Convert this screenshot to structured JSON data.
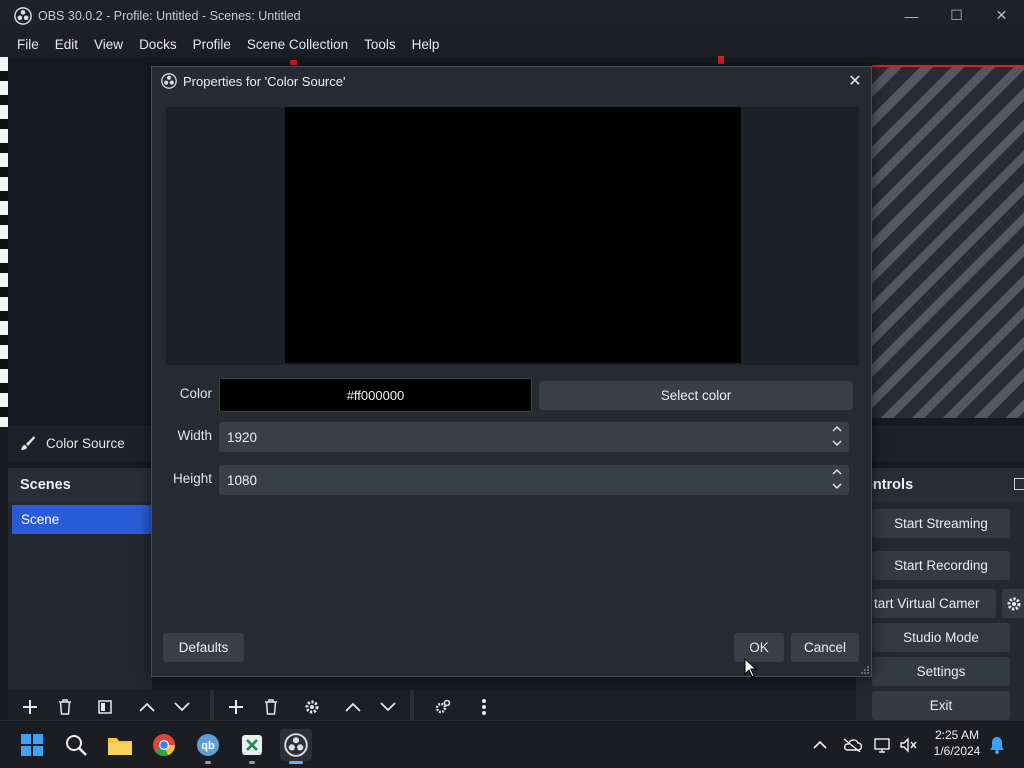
{
  "window": {
    "title": "OBS 30.0.2 - Profile: Untitled - Scenes: Untitled",
    "controls": {
      "minimize": "—",
      "maximize": "☐",
      "close": "✕"
    }
  },
  "menu": [
    "File",
    "Edit",
    "View",
    "Docks",
    "Profile",
    "Scene Collection",
    "Tools",
    "Help"
  ],
  "source_bar": {
    "label": "Color Source",
    "icon": "brush-icon"
  },
  "scenes": {
    "header": "Scenes",
    "items": [
      "Scene"
    ],
    "selected": "Scene"
  },
  "controls": {
    "header": "ontrols",
    "buttons": [
      "Start Streaming",
      "Start Recording",
      "tart Virtual Camer",
      "Studio Mode",
      "Settings",
      "Exit"
    ]
  },
  "dialog": {
    "title": "Properties for 'Color Source'",
    "close": "✕",
    "color_label": "Color",
    "color_value": "#ff000000",
    "select_color": "Select color",
    "width_label": "Width",
    "width_value": "1920",
    "height_label": "Height",
    "height_value": "1080",
    "defaults": "Defaults",
    "ok": "OK",
    "cancel": "Cancel"
  },
  "taskbar": {
    "time": "2:25 AM",
    "date": "1/6/2024",
    "apps": [
      "start-icon",
      "search-icon",
      "file-explorer-icon",
      "chrome-icon",
      "qbittorrent-icon",
      "excel-icon",
      "obs-icon"
    ],
    "active_app": "obs-icon"
  },
  "colors": {
    "accent": "#2a5bd8",
    "dialog_bg": "#272a33",
    "button_bg": "#3a3e49",
    "recording_red": "#e21f1f"
  }
}
